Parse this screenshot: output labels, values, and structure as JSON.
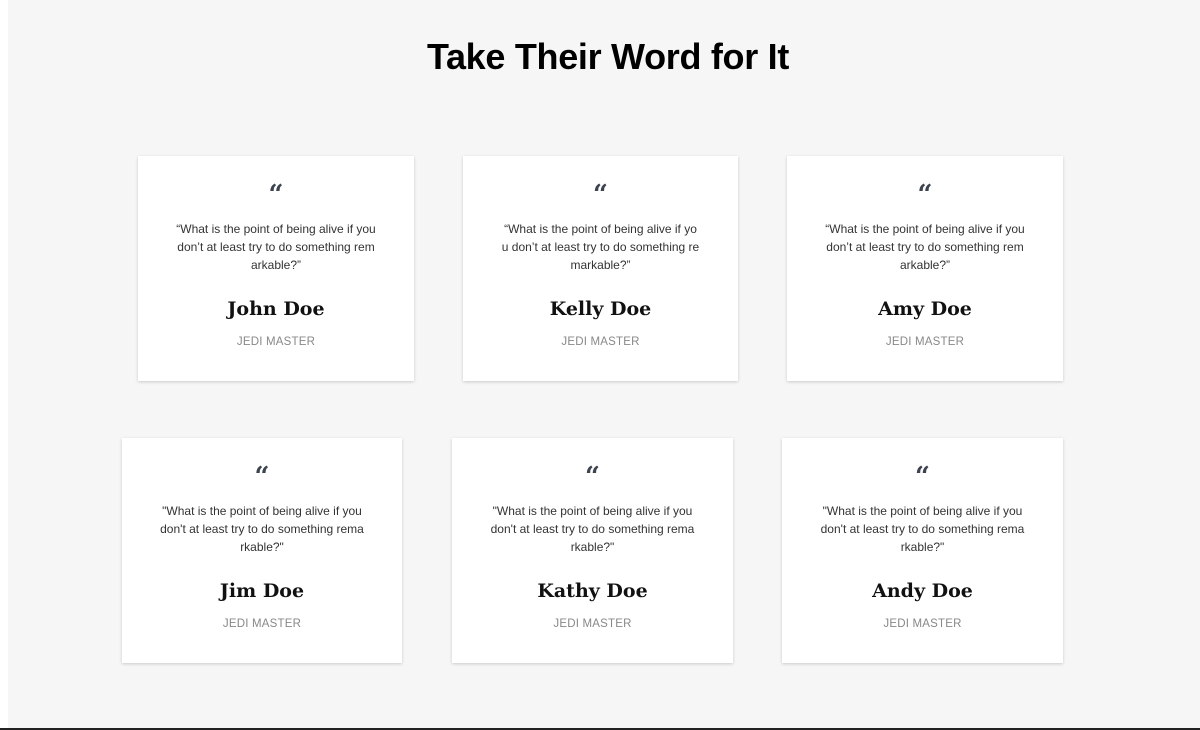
{
  "section": {
    "title": "Take Their Word for It"
  },
  "icons": {
    "quote": "quote-icon",
    "quote_glyph": "“"
  },
  "testimonials": [
    {
      "quote": "“What is the point of being alive if you don’t at least try to do something remarkable?”",
      "name": "John Doe",
      "role": "JEDI MASTER"
    },
    {
      "quote": "“What is the point of being alive if you don’t at least try to do something remarkable?”",
      "name": "Kelly Doe",
      "role": "JEDI MASTER"
    },
    {
      "quote": "“What is the point of being alive if you don’t at least try to do something remarkable?”",
      "name": "Amy Doe",
      "role": "JEDI MASTER"
    },
    {
      "quote": "\"What is the point of being alive if you don't at least try to do something remarkable?\"",
      "name": "Jim Doe",
      "role": "JEDI MASTER"
    },
    {
      "quote": "\"What is the point of being alive if you don't at least try to do something remarkable?\"",
      "name": "Kathy Doe",
      "role": "JEDI MASTER"
    },
    {
      "quote": "\"What is the point of being alive if you don't at least try to do something remarkable?\"",
      "name": "Andy Doe",
      "role": "JEDI MASTER"
    }
  ],
  "colors": {
    "background": "#f6f6f6",
    "card": "#ffffff",
    "quote_icon": "#3d4450",
    "role_text": "#888888"
  }
}
